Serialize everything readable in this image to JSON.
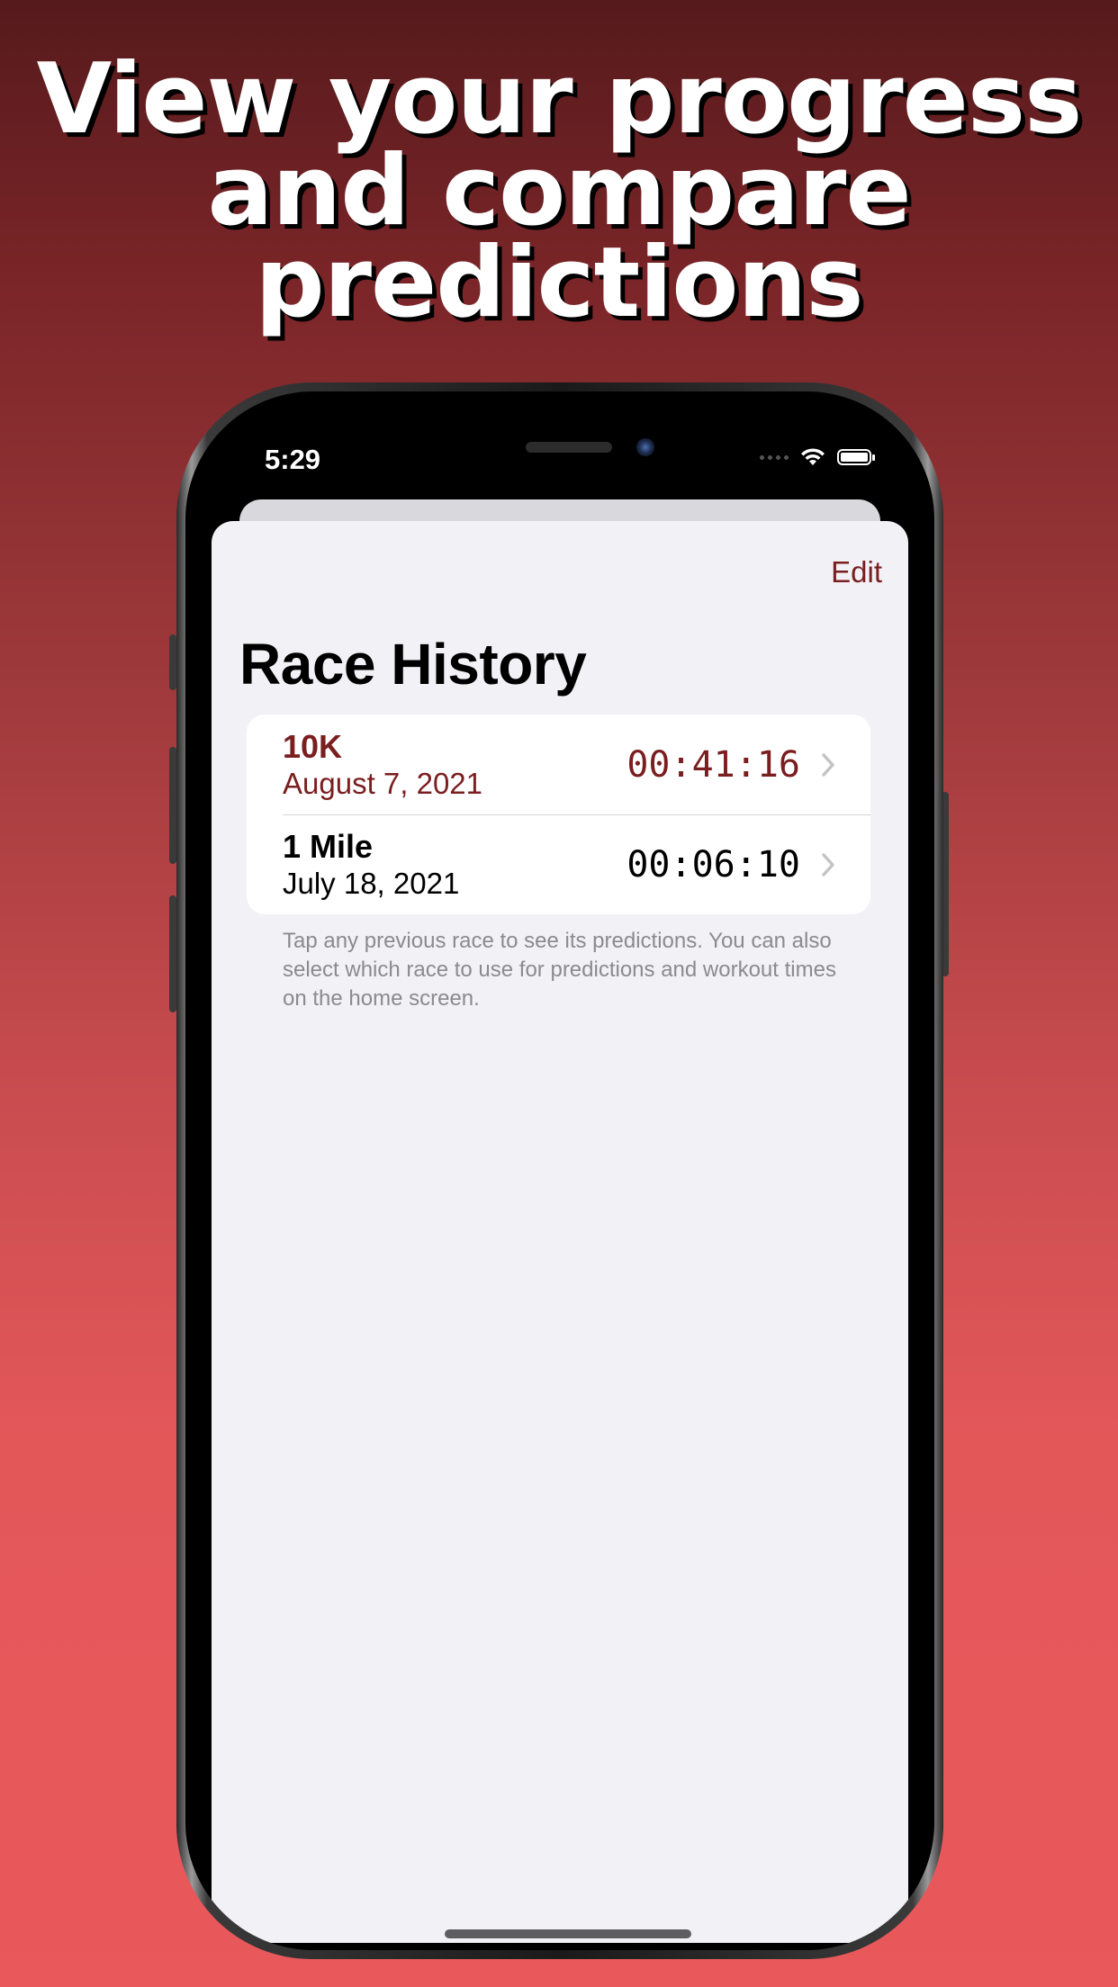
{
  "promo": {
    "headline": "View your progress\nand compare\npredictions"
  },
  "status_bar": {
    "time": "5:29",
    "icons": [
      "cellular-dots-icon",
      "wifi-icon",
      "battery-icon"
    ]
  },
  "nav": {
    "edit_label": "Edit",
    "title": "Race History"
  },
  "races": [
    {
      "name": "10K",
      "date": "August 7, 2021",
      "time": "00:41:16",
      "selected": true
    },
    {
      "name": "1 Mile",
      "date": "July 18, 2021",
      "time": "00:06:10",
      "selected": false
    }
  ],
  "footer_note": "Tap any previous race to see its predictions. You can also select which race to use for predictions and workout times on the home screen.",
  "colors": {
    "accent": "#7a1e1f",
    "sheet_background": "#f2f1f6",
    "note_text": "#8a8a8f",
    "background_top": "#561a1c",
    "background_bottom": "#e9585b"
  }
}
